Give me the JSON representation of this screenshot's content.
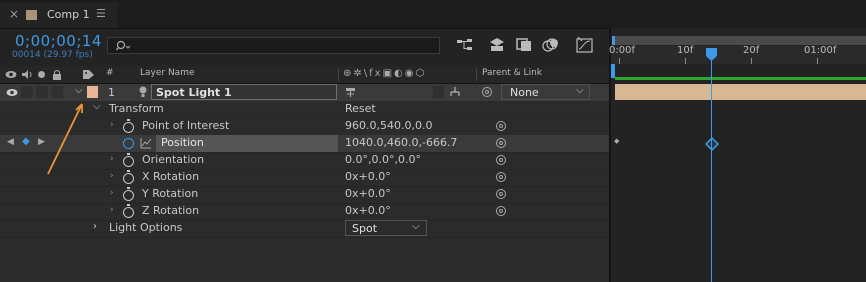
{
  "tab": {
    "title": "Comp 1"
  },
  "time": {
    "timecode": "0;00;00;14",
    "frames": "00014 (29.97 fps)"
  },
  "columns": {
    "num": "#",
    "layer_name": "Layer Name",
    "parent_link": "Parent & Link"
  },
  "layer": {
    "number": "1",
    "name": "Spot Light 1",
    "parent": "None",
    "label_color": "#e8b896"
  },
  "transform": {
    "label": "Transform",
    "reset": "Reset",
    "properties": [
      {
        "name": "Point of Interest",
        "value": "960.0,540.0,0.0"
      },
      {
        "name": "Position",
        "value": "1040.0,460.0,-666.7"
      },
      {
        "name": "Orientation",
        "value": "0.0°,0.0°,0.0°"
      },
      {
        "name": "X Rotation",
        "value": "0x+0.0°"
      },
      {
        "name": "Y Rotation",
        "value": "0x+0.0°"
      },
      {
        "name": "Z Rotation",
        "value": "0x+0.0°"
      }
    ]
  },
  "light_options": {
    "label": "Light Options",
    "type": "Spot"
  },
  "ruler": {
    "labels": [
      "0:00f",
      "10f",
      "20f",
      "01:00f"
    ]
  },
  "colors": {
    "accent": "#3d9ae8",
    "layer_bar": "#d8b892",
    "work_area": "#2fa82f"
  }
}
